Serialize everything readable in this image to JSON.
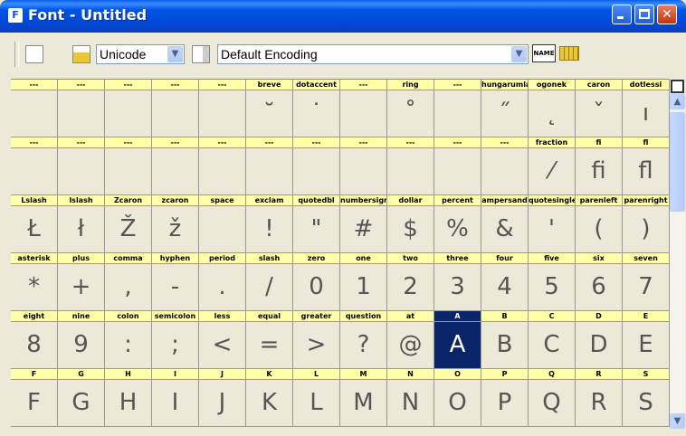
{
  "window": {
    "title": "Font - Untitled",
    "app_icon": "F"
  },
  "toolbar": {
    "encoding_mode": "Unicode",
    "encoding": "Default Encoding",
    "name_button": "NAME"
  },
  "rows": [
    {
      "cells": [
        {
          "name": "---",
          "glyph": ""
        },
        {
          "name": "---",
          "glyph": ""
        },
        {
          "name": "---",
          "glyph": ""
        },
        {
          "name": "---",
          "glyph": ""
        },
        {
          "name": "---",
          "glyph": ""
        },
        {
          "name": "breve",
          "glyph": "˘"
        },
        {
          "name": "dotaccent",
          "glyph": "˙"
        },
        {
          "name": "---",
          "glyph": ""
        },
        {
          "name": "ring",
          "glyph": "˚"
        },
        {
          "name": "---",
          "glyph": ""
        },
        {
          "name": "hungarumlaut",
          "glyph": "˝"
        },
        {
          "name": "ogonek",
          "glyph": "˛"
        },
        {
          "name": "caron",
          "glyph": "ˇ"
        },
        {
          "name": "dotlessi",
          "glyph": "ı"
        }
      ]
    },
    {
      "cells": [
        {
          "name": "---",
          "glyph": ""
        },
        {
          "name": "---",
          "glyph": ""
        },
        {
          "name": "---",
          "glyph": ""
        },
        {
          "name": "---",
          "glyph": ""
        },
        {
          "name": "---",
          "glyph": ""
        },
        {
          "name": "---",
          "glyph": ""
        },
        {
          "name": "---",
          "glyph": ""
        },
        {
          "name": "---",
          "glyph": ""
        },
        {
          "name": "---",
          "glyph": ""
        },
        {
          "name": "---",
          "glyph": ""
        },
        {
          "name": "---",
          "glyph": ""
        },
        {
          "name": "fraction",
          "glyph": "⁄"
        },
        {
          "name": "fi",
          "glyph": "ﬁ"
        },
        {
          "name": "fl",
          "glyph": "ﬂ"
        }
      ]
    },
    {
      "cells": [
        {
          "name": "Lslash",
          "glyph": "Ł"
        },
        {
          "name": "lslash",
          "glyph": "ł"
        },
        {
          "name": "Zcaron",
          "glyph": "Ž"
        },
        {
          "name": "zcaron",
          "glyph": "ž"
        },
        {
          "name": "space",
          "glyph": ""
        },
        {
          "name": "exclam",
          "glyph": "!"
        },
        {
          "name": "quotedbl",
          "glyph": "\""
        },
        {
          "name": "numbersign",
          "glyph": "#"
        },
        {
          "name": "dollar",
          "glyph": "$"
        },
        {
          "name": "percent",
          "glyph": "%"
        },
        {
          "name": "ampersand",
          "glyph": "&"
        },
        {
          "name": "quotesingle",
          "glyph": "'"
        },
        {
          "name": "parenleft",
          "glyph": "("
        },
        {
          "name": "parenright",
          "glyph": ")"
        }
      ]
    },
    {
      "cells": [
        {
          "name": "asterisk",
          "glyph": "*"
        },
        {
          "name": "plus",
          "glyph": "+"
        },
        {
          "name": "comma",
          "glyph": ","
        },
        {
          "name": "hyphen",
          "glyph": "-"
        },
        {
          "name": "period",
          "glyph": "."
        },
        {
          "name": "slash",
          "glyph": "/"
        },
        {
          "name": "zero",
          "glyph": "0"
        },
        {
          "name": "one",
          "glyph": "1"
        },
        {
          "name": "two",
          "glyph": "2"
        },
        {
          "name": "three",
          "glyph": "3"
        },
        {
          "name": "four",
          "glyph": "4"
        },
        {
          "name": "five",
          "glyph": "5"
        },
        {
          "name": "six",
          "glyph": "6"
        },
        {
          "name": "seven",
          "glyph": "7"
        }
      ]
    },
    {
      "cells": [
        {
          "name": "eight",
          "glyph": "8"
        },
        {
          "name": "nine",
          "glyph": "9"
        },
        {
          "name": "colon",
          "glyph": ":"
        },
        {
          "name": "semicolon",
          "glyph": ";"
        },
        {
          "name": "less",
          "glyph": "<"
        },
        {
          "name": "equal",
          "glyph": "="
        },
        {
          "name": "greater",
          "glyph": ">"
        },
        {
          "name": "question",
          "glyph": "?"
        },
        {
          "name": "at",
          "glyph": "@"
        },
        {
          "name": "A",
          "glyph": "A",
          "selected": true
        },
        {
          "name": "B",
          "glyph": "B"
        },
        {
          "name": "C",
          "glyph": "C"
        },
        {
          "name": "D",
          "glyph": "D"
        },
        {
          "name": "E",
          "glyph": "E"
        }
      ]
    },
    {
      "cells": [
        {
          "name": "F",
          "glyph": "F"
        },
        {
          "name": "G",
          "glyph": "G"
        },
        {
          "name": "H",
          "glyph": "H"
        },
        {
          "name": "I",
          "glyph": "I"
        },
        {
          "name": "J",
          "glyph": "J"
        },
        {
          "name": "K",
          "glyph": "K"
        },
        {
          "name": "L",
          "glyph": "L"
        },
        {
          "name": "M",
          "glyph": "M"
        },
        {
          "name": "N",
          "glyph": "N"
        },
        {
          "name": "O",
          "glyph": "O"
        },
        {
          "name": "P",
          "glyph": "P"
        },
        {
          "name": "Q",
          "glyph": "Q"
        },
        {
          "name": "R",
          "glyph": "R"
        },
        {
          "name": "S",
          "glyph": "S"
        }
      ]
    }
  ]
}
